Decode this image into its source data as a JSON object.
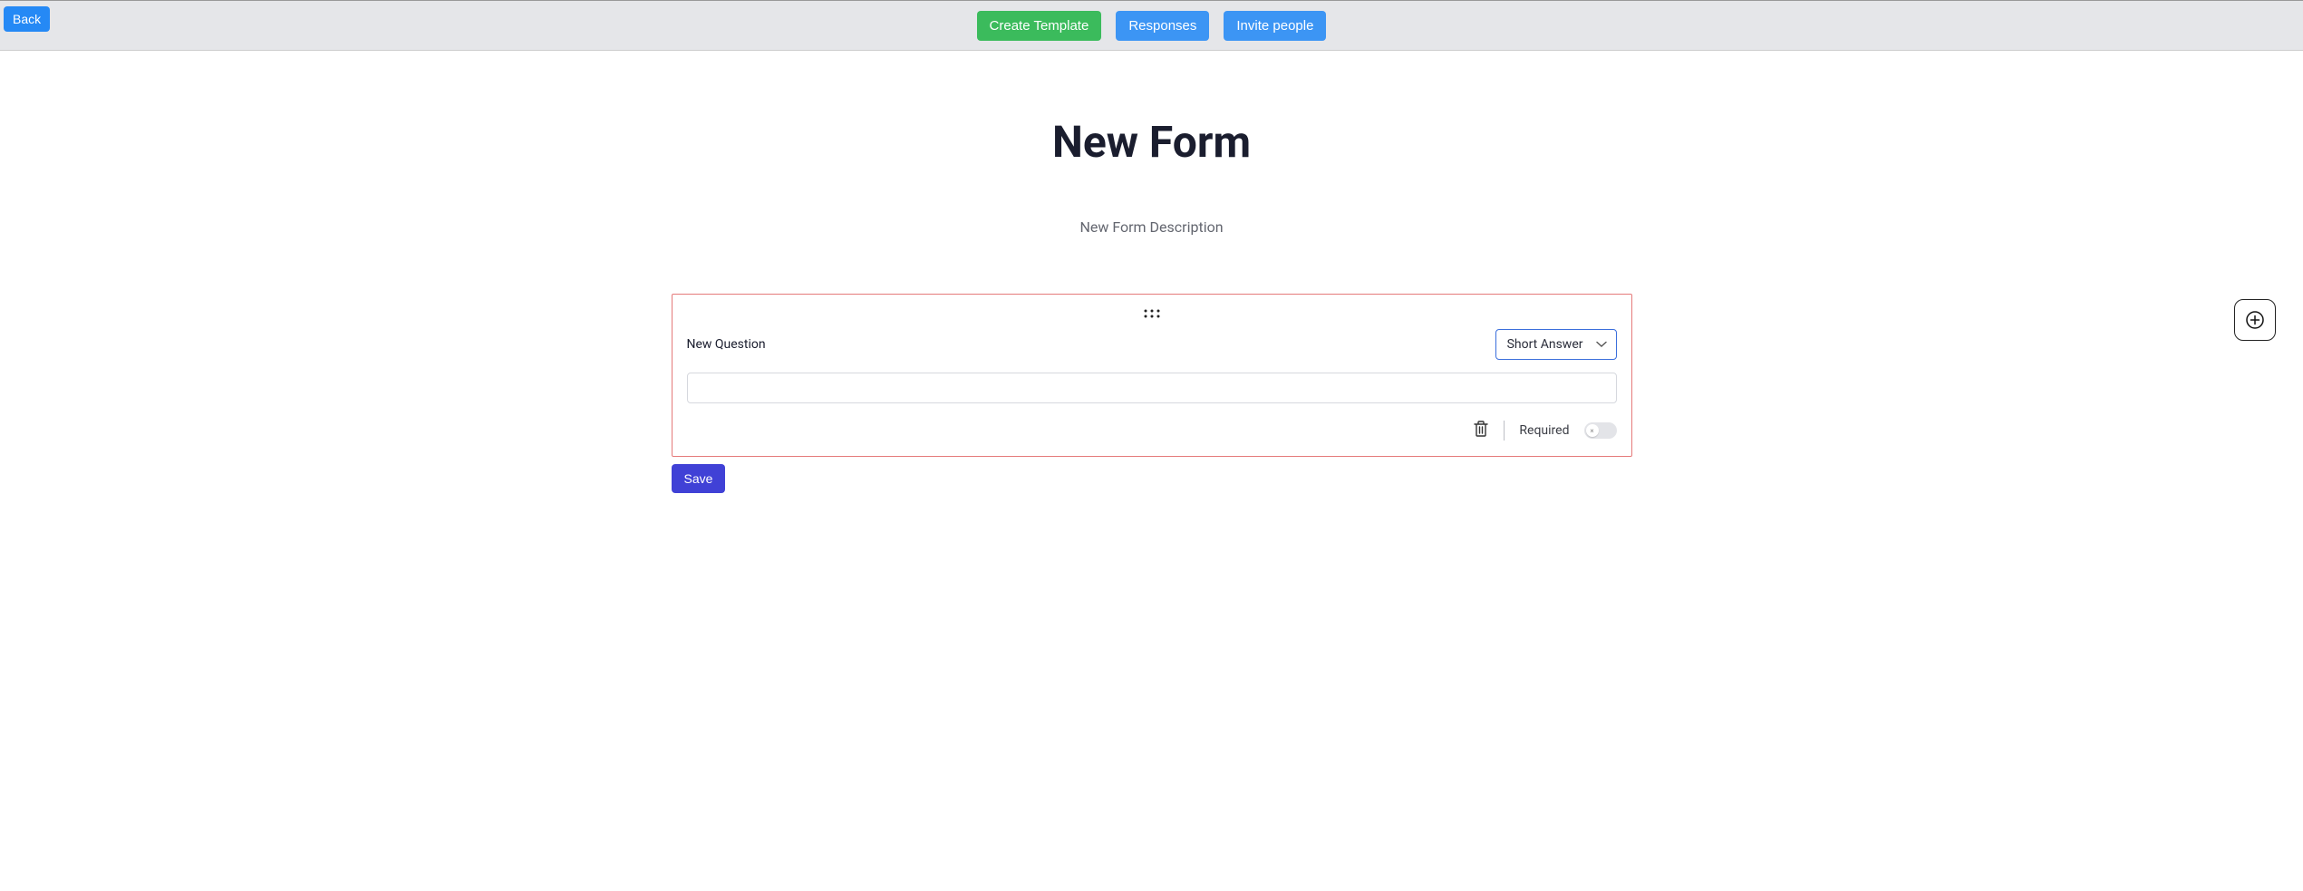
{
  "header": {
    "back_label": "Back",
    "create_template_label": "Create Template",
    "responses_label": "Responses",
    "invite_label": "Invite people"
  },
  "form": {
    "title": "New Form",
    "description": "New Form Description"
  },
  "question": {
    "title": "New Question",
    "type_selected": "Short Answer",
    "answer_value": "",
    "required_label": "Required",
    "required_on": false
  },
  "actions": {
    "save_label": "Save"
  }
}
